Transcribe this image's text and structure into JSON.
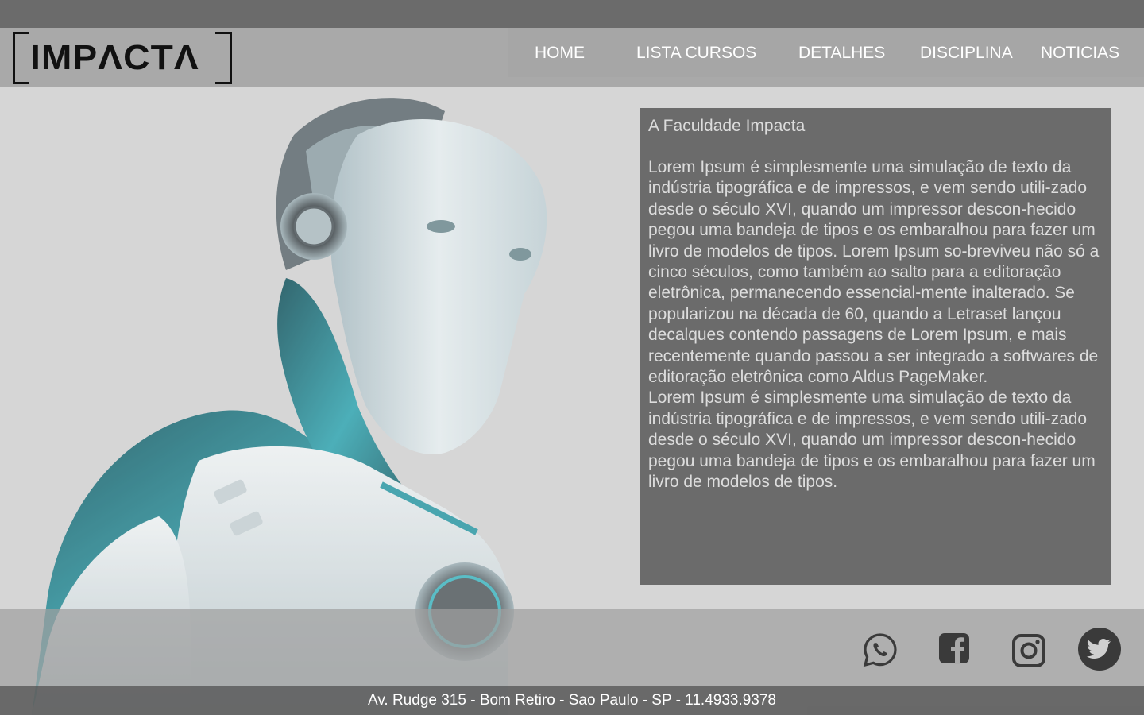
{
  "brand": {
    "logo_text": "IMPΛCTΛ"
  },
  "nav": [
    {
      "label": "HOME"
    },
    {
      "label": "LISTA CURSOS"
    },
    {
      "label": "DETALHES"
    },
    {
      "label": "DISCIPLINA"
    },
    {
      "label": "NOTICIAS"
    }
  ],
  "content": {
    "title": "A Faculdade Impacta",
    "paragraphs": [
      "Lorem Ipsum é simplesmente uma simulação de texto da indústria tipográfica e de impressos, e vem sendo utili-zado desde o século XVI, quando um impressor descon-hecido pegou uma bandeja de tipos e os embaralhou para fazer um livro de modelos de tipos. Lorem Ipsum so-breviveu não só a cinco séculos, como também ao salto para a editoração eletrônica, permanecendo essencial-mente inalterado. Se popularizou na década de 60, quando a Letraset lançou decalques contendo passagens de Lorem Ipsum, e mais recentemente quando passou a ser integrado a softwares de editoração eletrônica como Aldus PageMaker.",
      "Lorem Ipsum é simplesmente uma simulação de texto da indústria tipográfica e de impressos, e vem sendo utili-zado desde o século XVI, quando um impressor descon-hecido pegou uma bandeja de tipos e os embaralhou para fazer um livro de modelos de tipos."
    ]
  },
  "social": [
    {
      "icon": "whatsapp-icon"
    },
    {
      "icon": "facebook-icon"
    },
    {
      "icon": "instagram-icon"
    },
    {
      "icon": "twitter-icon"
    }
  ],
  "footer": {
    "address": "Av. Rudge 315 - Bom Retiro - Sao Paulo - SP - 11.4933.9378"
  },
  "colors": {
    "header_bg": "#a9a9a9",
    "top_strip": "#6b6b6b",
    "text_box": "#6b6b6b",
    "accent_teal": "#2a9aa6"
  }
}
